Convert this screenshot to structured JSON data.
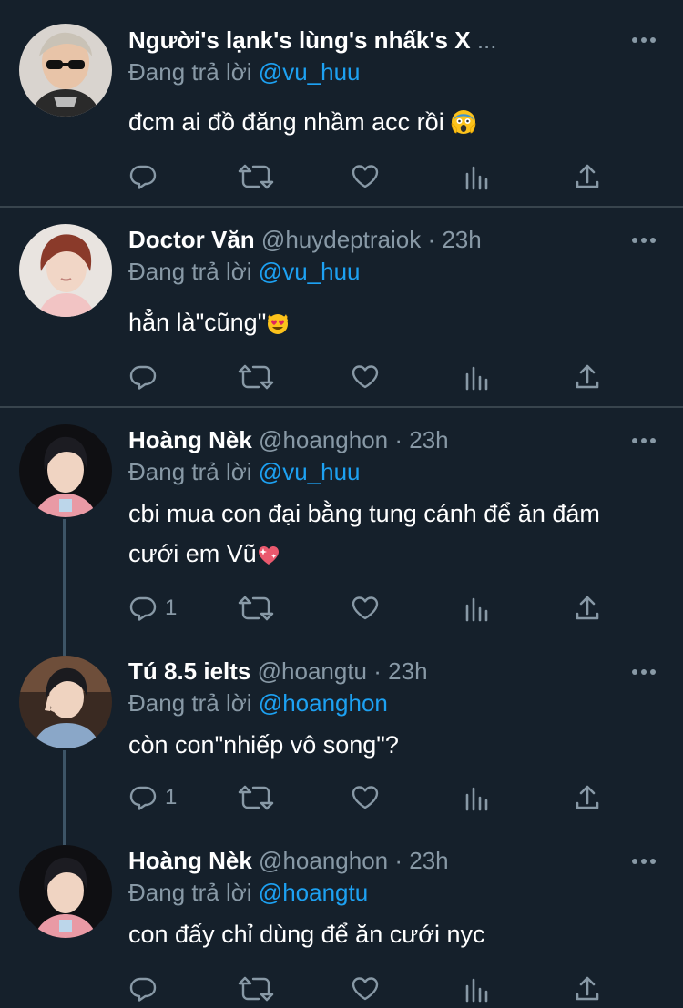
{
  "tweets": [
    {
      "name": "Người's lạnk's lùng's nhấk's X",
      "handle": "",
      "time": "",
      "reply_label": "Đang trả lời",
      "reply_to": "@vu_huu",
      "text": "đcm ai đồ đăng nhầm acc rồi",
      "emoji": "scream-emoji",
      "reply_count": "",
      "avatar": "avatar-sunglasses"
    },
    {
      "name": "Doctor Văn",
      "handle": "@huydeptraiok",
      "time": "23h",
      "reply_label": "Đang trả lời",
      "reply_to": "@vu_huu",
      "text": "hẳn là\"cũng\"",
      "emoji": "heart-eyes-cat-emoji",
      "reply_count": "",
      "avatar": "avatar-red-hair"
    },
    {
      "name": "Hoàng Nèk",
      "handle": "@hoanghon",
      "time": "23h",
      "reply_label": "Đang trả lời",
      "reply_to": "@vu_huu",
      "text_line1": "cbi mua con đại bằng tung cánh để ăn đám",
      "text_line2": "cưới em Vũ",
      "emoji": "sparkling-heart-emoji",
      "reply_count": "1",
      "avatar": "avatar-dark-hair"
    },
    {
      "name": "Tú 8.5 ielts",
      "handle": "@hoangtu",
      "time": "23h",
      "reply_label": "Đang trả lời",
      "reply_to": "@hoanghon",
      "text": "còn con\"nhiếp vô song\"?",
      "reply_count": "1",
      "avatar": "avatar-peace-sign"
    },
    {
      "name": "Hoàng Nèk",
      "handle": "@hoanghon",
      "time": "23h",
      "reply_label": "Đang trả lời",
      "reply_to": "@hoangtu",
      "text": "con đấy chỉ dùng để ăn cưới nyc",
      "reply_count": "",
      "avatar": "avatar-dark-hair"
    }
  ],
  "separator": "·",
  "ellipsis": "...",
  "colors": {
    "background": "#15202b",
    "secondary": "#8899a6",
    "accent": "#1da1f2",
    "divider": "#38444d"
  }
}
